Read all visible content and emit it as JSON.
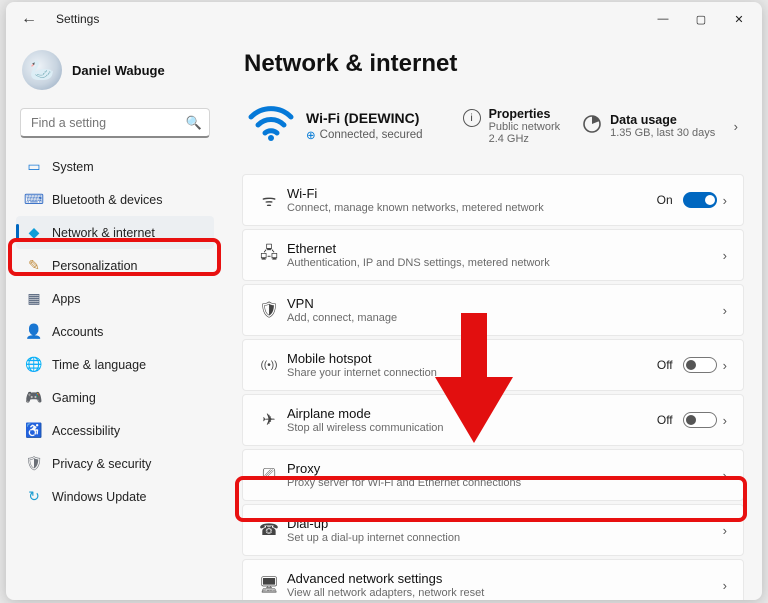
{
  "window": {
    "title": "Settings"
  },
  "user": {
    "name": "Daniel Wabuge"
  },
  "search": {
    "placeholder": "Find a setting"
  },
  "nav": {
    "items": [
      {
        "label": "System",
        "icon": "system-icon",
        "color": "#1e7cd6",
        "glyph": "▭"
      },
      {
        "label": "Bluetooth & devices",
        "icon": "bluetooth-icon",
        "color": "#3f75c8",
        "glyph": "⌨"
      },
      {
        "label": "Network & internet",
        "icon": "network-icon",
        "color": "#0f9ed8",
        "glyph": "◆",
        "active": true
      },
      {
        "label": "Personalization",
        "icon": "personalization-icon",
        "color": "#c08a3a",
        "glyph": "✎"
      },
      {
        "label": "Apps",
        "icon": "apps-icon",
        "color": "#4a5b74",
        "glyph": "▦"
      },
      {
        "label": "Accounts",
        "icon": "accounts-icon",
        "color": "#c06a6a",
        "glyph": "👤"
      },
      {
        "label": "Time & language",
        "icon": "time-language-icon",
        "color": "#4a7d9e",
        "glyph": "🌐"
      },
      {
        "label": "Gaming",
        "icon": "gaming-icon",
        "color": "#6aa24a",
        "glyph": "🎮"
      },
      {
        "label": "Accessibility",
        "icon": "accessibility-icon",
        "color": "#3a74c8",
        "glyph": "♿"
      },
      {
        "label": "Privacy & security",
        "icon": "privacy-icon",
        "color": "#6a6f76",
        "glyph": "🛡"
      },
      {
        "label": "Windows Update",
        "icon": "update-icon",
        "color": "#1f9ed1",
        "glyph": "↻"
      }
    ]
  },
  "page": {
    "title": "Network & internet",
    "net": {
      "name": "Wi-Fi (DEEWINC)",
      "status": "Connected, secured"
    },
    "properties": {
      "title": "Properties",
      "sub": "Public network\n2.4 GHz"
    },
    "usage": {
      "title": "Data usage",
      "sub": "1.35 GB, last 30 days"
    },
    "cards": [
      {
        "key": "wifi",
        "title": "Wi-Fi",
        "sub": "Connect, manage known networks, metered network",
        "icon": "wifi-icon",
        "glyph": "ᯤ",
        "toggle": "On"
      },
      {
        "key": "ethernet",
        "title": "Ethernet",
        "sub": "Authentication, IP and DNS settings, metered network",
        "icon": "ethernet-icon",
        "glyph": "🖧"
      },
      {
        "key": "vpn",
        "title": "VPN",
        "sub": "Add, connect, manage",
        "icon": "vpn-icon",
        "glyph": "🛡"
      },
      {
        "key": "hotspot",
        "title": "Mobile hotspot",
        "sub": "Share your internet connection",
        "icon": "hotspot-icon",
        "glyph": "((•))",
        "toggle": "Off"
      },
      {
        "key": "airplane",
        "title": "Airplane mode",
        "sub": "Stop all wireless communication",
        "icon": "airplane-icon",
        "glyph": "✈",
        "toggle": "Off"
      },
      {
        "key": "proxy",
        "title": "Proxy",
        "sub": "Proxy server for Wi-Fi and Ethernet connections",
        "icon": "proxy-icon",
        "glyph": "⎚"
      },
      {
        "key": "dialup",
        "title": "Dial-up",
        "sub": "Set up a dial-up internet connection",
        "icon": "dialup-icon",
        "glyph": "☎"
      },
      {
        "key": "advanced",
        "title": "Advanced network settings",
        "sub": "View all network adapters, network reset",
        "icon": "advanced-icon",
        "glyph": "🖥"
      }
    ]
  }
}
